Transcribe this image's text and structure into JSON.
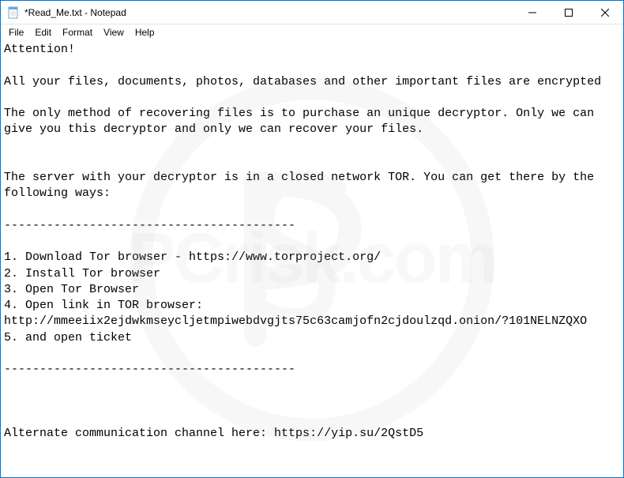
{
  "window": {
    "title": "*Read_Me.txt - Notepad"
  },
  "menu": {
    "file": "File",
    "edit": "Edit",
    "format": "Format",
    "view": "View",
    "help": "Help"
  },
  "content": {
    "text": "Attention!\n\nAll your files, documents, photos, databases and other important files are encrypted\n\nThe only method of recovering files is to purchase an unique decryptor. Only we can give you this decryptor and only we can recover your files.\n\n\nThe server with your decryptor is in a closed network TOR. You can get there by the following ways:\n\n-----------------------------------------\n\n1. Download Tor browser - https://www.torproject.org/\n2. Install Tor browser\n3. Open Tor Browser\n4. Open link in TOR browser: http://mmeeiix2ejdwkmseycljetmpiwebdvgjts75c63camjofn2cjdoulzqd.onion/?101NELNZQXO\n5. and open ticket\n\n-----------------------------------------\n\n\n\nAlternate communication channel here: https://yip.su/2QstD5"
  },
  "watermark": {
    "text": "PCrisk.com"
  }
}
